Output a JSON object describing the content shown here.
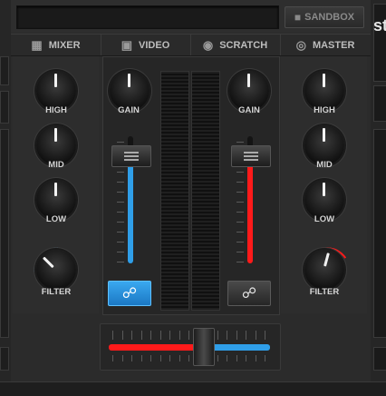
{
  "toolbar": {
    "sandbox_label": "SANDBOX"
  },
  "deck_right": {
    "title_fragment": "st"
  },
  "tabs": [
    {
      "label": "MIXER",
      "icon": "mixer-icon"
    },
    {
      "label": "VIDEO",
      "icon": "film-icon"
    },
    {
      "label": "SCRATCH",
      "icon": "record-icon"
    },
    {
      "label": "MASTER",
      "icon": "target-icon"
    }
  ],
  "left_eq": {
    "high": "HIGH",
    "mid": "MID",
    "low": "LOW",
    "filter": "FILTER"
  },
  "right_eq": {
    "high": "HIGH",
    "mid": "MID",
    "low": "LOW",
    "filter": "FILTER"
  },
  "left_channel": {
    "gain_label": "GAIN",
    "fader_color": "#2f9ee8",
    "fader_level": 0.85,
    "headphone_active": true
  },
  "right_channel": {
    "gain_label": "GAIN",
    "fader_color": "#ff1a1a",
    "fader_level": 0.85,
    "headphone_active": false
  },
  "crossfader": {
    "position": 0.59,
    "left_color": "#ff1a1a",
    "right_color": "#2f9ee8"
  },
  "colors": {
    "accent_blue": "#2f9ee8",
    "accent_red": "#ff1a1a",
    "background": "#2b2b2b"
  }
}
